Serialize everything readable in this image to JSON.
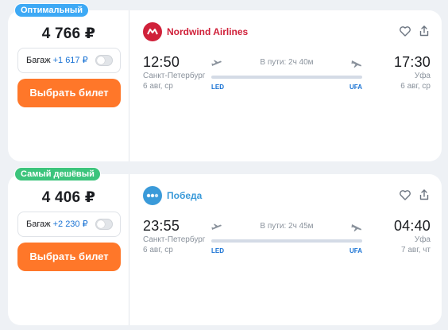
{
  "colors": {
    "badge_optimal": "#3da9f5",
    "badge_cheapest": "#3cc47c",
    "accent_orange": "#ff7729",
    "link_blue": "#1a73d4",
    "nordwind_red": "#d0213a",
    "pobeda_blue": "#3a9ad9"
  },
  "offers": [
    {
      "badge": "Оптимальный",
      "price": "4 766 ₽",
      "baggage": {
        "label": "Багаж",
        "price": "+1 617 ₽",
        "enabled": false
      },
      "buy_label": "Выбрать билет",
      "airline": {
        "name": "Nordwind Airlines",
        "logo_icon": "nordwind-logo-icon"
      },
      "departure": {
        "time": "12:50",
        "city": "Санкт-Петербург",
        "date": "6 авг, ср",
        "code": "LED"
      },
      "arrival": {
        "time": "17:30",
        "city": "Уфа",
        "date": "6 авг, ср",
        "code": "UFA"
      },
      "duration": "В пути: 2ч 40м"
    },
    {
      "badge": "Самый дешёвый",
      "price": "4 406 ₽",
      "baggage": {
        "label": "Багаж",
        "price": "+2 230 ₽",
        "enabled": false
      },
      "buy_label": "Выбрать билет",
      "airline": {
        "name": "Победа",
        "logo_icon": "pobeda-logo-icon"
      },
      "departure": {
        "time": "23:55",
        "city": "Санкт-Петербург",
        "date": "6 авг, ср",
        "code": "LED"
      },
      "arrival": {
        "time": "04:40",
        "city": "Уфа",
        "date": "7 авг, чт",
        "code": "UFA"
      },
      "duration": "В пути: 2ч 45м"
    }
  ]
}
